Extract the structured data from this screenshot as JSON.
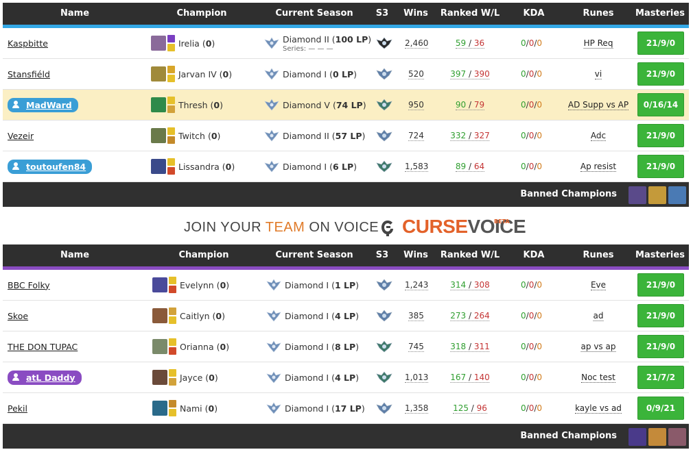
{
  "columns": [
    "Name",
    "Champion",
    "Current Season",
    "S3",
    "Wins",
    "Ranked W/L",
    "KDA",
    "Runes",
    "Masteries"
  ],
  "colors": {
    "team1_stripe": "#33a8e6",
    "team2_stripe": "#8a4cc2",
    "pill_blue": "#3a9ed6",
    "pill_purple": "#8a4cc2",
    "mastery_green": "#3bb43a",
    "highlight": "#fbefc4"
  },
  "teams": [
    {
      "players": [
        {
          "name": "Kaspbitte",
          "champion": "Irelia",
          "champ_count": "0",
          "champ_color": "#8a6a9a",
          "spell1": "#7a3fc2",
          "spell2": "#e6c02a",
          "rank": "Diamond II",
          "lp": "100 LP",
          "series": "Series:",
          "series_marks": "— — —",
          "s3_icon": "challenger-badge-icon",
          "wins": "2,460",
          "rw": "59",
          "rl": "36",
          "kda": [
            "0",
            "0",
            "0"
          ],
          "runes": "HP Req",
          "masteries": "21/9/0",
          "pill": false,
          "highlight": false
        },
        {
          "name": "Stansfiéld",
          "champion": "Jarvan IV",
          "champ_count": "0",
          "champ_color": "#a08a3a",
          "spell1": "#d8a62a",
          "spell2": "#e6c02a",
          "rank": "Diamond I",
          "lp": "0 LP",
          "series": "",
          "series_marks": "",
          "s3_icon": "diamond-badge-icon",
          "wins": "520",
          "rw": "397",
          "rl": "390",
          "kda": [
            "0",
            "0",
            "0"
          ],
          "runes": "vi",
          "masteries": "21/9/0",
          "pill": false,
          "highlight": false
        },
        {
          "name": "MadWard",
          "champion": "Thresh",
          "champ_count": "0",
          "champ_color": "#2f8a4a",
          "spell1": "#e6c02a",
          "spell2": "#d2a23a",
          "rank": "Diamond V",
          "lp": "74 LP",
          "series": "",
          "series_marks": "",
          "s3_icon": "platinum-badge-icon",
          "wins": "950",
          "rw": "90",
          "rl": "79",
          "kda": [
            "0",
            "0",
            "0"
          ],
          "runes": "AD Supp vs AP",
          "masteries": "0/16/14",
          "pill": true,
          "highlight": true
        },
        {
          "name": "Vezeir",
          "champion": "Twitch",
          "champ_count": "0",
          "champ_color": "#6a7a4a",
          "spell1": "#e6c02a",
          "spell2": "#c48a2a",
          "rank": "Diamond II",
          "lp": "57 LP",
          "series": "",
          "series_marks": "",
          "s3_icon": "diamond-badge-icon",
          "wins": "724",
          "rw": "332",
          "rl": "327",
          "kda": [
            "0",
            "0",
            "0"
          ],
          "runes": "Adc",
          "masteries": "21/9/0",
          "pill": false,
          "highlight": false
        },
        {
          "name": "toutoufen84",
          "champion": "Lissandra",
          "champ_count": "0",
          "champ_color": "#3a4a8a",
          "spell1": "#e6c02a",
          "spell2": "#d24a2a",
          "rank": "Diamond I",
          "lp": "6 LP",
          "series": "",
          "series_marks": "",
          "s3_icon": "platinum-badge-icon",
          "wins": "1,583",
          "rw": "89",
          "rl": "64",
          "kda": [
            "0",
            "0",
            "0"
          ],
          "runes": "Ap resist",
          "masteries": "21/9/0",
          "pill": true,
          "highlight": false
        }
      ],
      "banned_label": "Banned Champions",
      "bans": [
        "#5a4a8a",
        "#c49a3a",
        "#4a7ab4"
      ]
    },
    {
      "players": [
        {
          "name": "BBC Folky",
          "champion": "Evelynn",
          "champ_count": "0",
          "champ_color": "#4a4a9a",
          "spell1": "#e6c02a",
          "spell2": "#d24a2a",
          "rank": "Diamond I",
          "lp": "1 LP",
          "series": "",
          "series_marks": "",
          "s3_icon": "diamond-badge-icon",
          "wins": "1,243",
          "rw": "314",
          "rl": "308",
          "kda": [
            "0",
            "0",
            "0"
          ],
          "runes": "Eve",
          "masteries": "21/9/0",
          "pill": false,
          "highlight": false
        },
        {
          "name": "Skoe",
          "champion": "Caitlyn",
          "champ_count": "0",
          "champ_color": "#8a5a3a",
          "spell1": "#d2a23a",
          "spell2": "#e6c02a",
          "rank": "Diamond I",
          "lp": "4 LP",
          "series": "",
          "series_marks": "",
          "s3_icon": "diamond-badge-icon",
          "wins": "385",
          "rw": "273",
          "rl": "264",
          "kda": [
            "0",
            "0",
            "0"
          ],
          "runes": "ad",
          "masteries": "21/9/0",
          "pill": false,
          "highlight": false
        },
        {
          "name": "THE DON TUPAC",
          "champion": "Orianna",
          "champ_count": "0",
          "champ_color": "#7a8a6a",
          "spell1": "#e6c02a",
          "spell2": "#d24a2a",
          "rank": "Diamond I",
          "lp": "8 LP",
          "series": "",
          "series_marks": "",
          "s3_icon": "platinum-badge-icon",
          "wins": "745",
          "rw": "318",
          "rl": "311",
          "kda": [
            "0",
            "0",
            "0"
          ],
          "runes": "ap vs ap",
          "masteries": "21/9/0",
          "pill": false,
          "highlight": false
        },
        {
          "name": "atL Daddy",
          "champion": "Jayce",
          "champ_count": "0",
          "champ_color": "#6a4a3a",
          "spell1": "#e6c02a",
          "spell2": "#d2a23a",
          "rank": "Diamond I",
          "lp": "4 LP",
          "series": "",
          "series_marks": "",
          "s3_icon": "platinum-badge-icon",
          "wins": "1,013",
          "rw": "167",
          "rl": "140",
          "kda": [
            "0",
            "0",
            "0"
          ],
          "runes": "Noc test",
          "masteries": "21/7/2",
          "pill": true,
          "highlight": false
        },
        {
          "name": "Pekil",
          "champion": "Nami",
          "champ_count": "0",
          "champ_color": "#2a6a8a",
          "spell1": "#c48a2a",
          "spell2": "#e6c02a",
          "rank": "Diamond I",
          "lp": "17 LP",
          "series": "",
          "series_marks": "",
          "s3_icon": "diamond-badge-icon",
          "wins": "1,358",
          "rw": "125",
          "rl": "96",
          "kda": [
            "0",
            "0",
            "0"
          ],
          "runes": "kayle vs ad",
          "masteries": "0/9/21",
          "pill": false,
          "highlight": false
        }
      ],
      "banned_label": "Banned Champions",
      "bans": [
        "#4a3a8a",
        "#c48a3a",
        "#8a5a6a"
      ]
    }
  ],
  "promo": {
    "text_before": "JOIN YOUR ",
    "text_team": "TEAM",
    "text_after": " ON VOICE",
    "brand1": "CURSE",
    "brand2": "VOICE",
    "beta": "BETA",
    "logo_icon": "curse-logo-icon"
  }
}
